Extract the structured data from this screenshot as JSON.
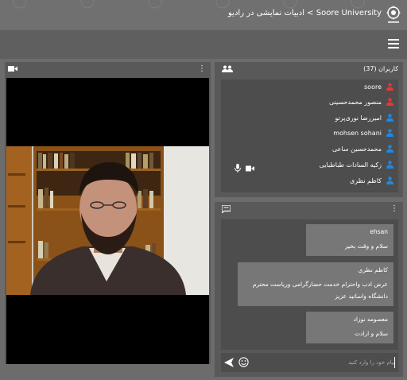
{
  "header": {
    "title": "Soore University > ادبیات نمایشی در رادیو",
    "logo_icon": "university-seal-icon"
  },
  "toolbar": {
    "menu_icon": "hamburger-menu-icon"
  },
  "video": {
    "camera_icon": "videocam-icon",
    "more_icon": "more-vert-icon",
    "dots": "⋮"
  },
  "users": {
    "count_label": "کاربران (37)",
    "people_icon": "people-icon",
    "list": [
      {
        "name": "soore",
        "role_color": "#e53935"
      },
      {
        "name": "منصور محمدحسینی",
        "role_color": "#e53935"
      },
      {
        "name": "امیررضا نوری‌پرتو",
        "role_color": "#1e88e5"
      },
      {
        "name": "mohsen sohani",
        "role_color": "#1e88e5"
      },
      {
        "name": "محمدحسین ساعی",
        "role_color": "#1e88e5"
      },
      {
        "name": "زکیه السادات طباطبایی",
        "role_color": "#1e88e5"
      },
      {
        "name": "کاظم نظری",
        "role_color": "#1e88e5"
      }
    ]
  },
  "chat": {
    "chat_icon": "chat-icon",
    "dots": "⋮",
    "messages": [
      {
        "sender": "ehsan",
        "text": "سلام و وقت بخیر"
      },
      {
        "sender": "کاظم نظری",
        "text": "عرض ادب واحترام خدمت حضارگرامی وریاست محترم دانشگاه واساتید عزیز"
      },
      {
        "sender": "معصومه نوزاد",
        "text": "سلام و ارادت"
      }
    ],
    "input_placeholder": "پیام خود را وارد کنید",
    "send_icon": "send-icon",
    "emoji_icon": "emoji-icon"
  },
  "colors": {
    "topbar": "#707070",
    "toolbar": "#5f5f5f",
    "panel": "#595959",
    "panel_inner": "#4d4d4d",
    "bubble": "#777777",
    "moderator": "#e53935",
    "viewer": "#1e88e5"
  }
}
